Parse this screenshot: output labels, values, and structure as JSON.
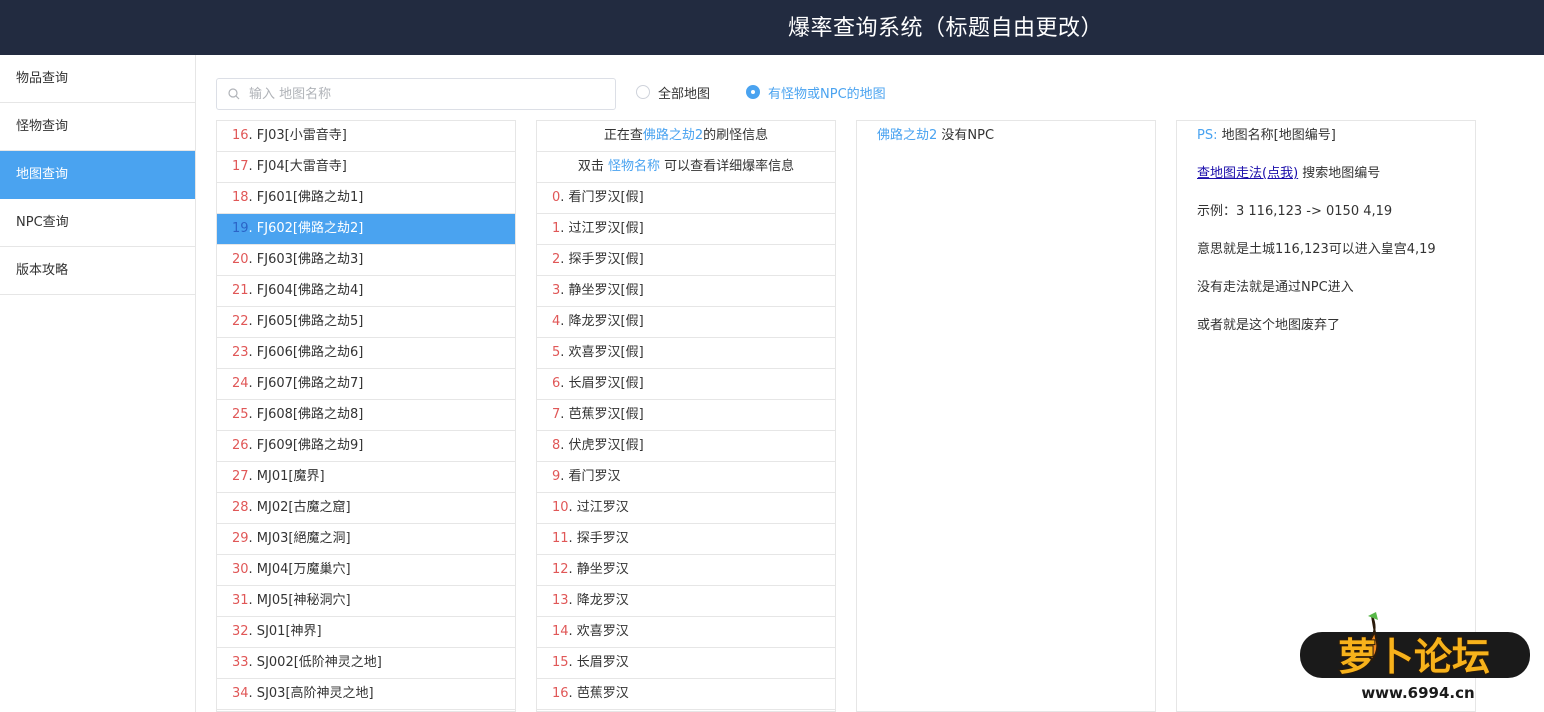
{
  "header": {
    "title": "爆率查询系统（标题自由更改）"
  },
  "sidebar": {
    "items": [
      {
        "label": "物品查询"
      },
      {
        "label": "怪物查询"
      },
      {
        "label": "地图查询",
        "active": true
      },
      {
        "label": "NPC查询"
      },
      {
        "label": "版本攻略"
      }
    ]
  },
  "search": {
    "placeholder": "输入 地图名称",
    "value": ""
  },
  "filter": {
    "options": [
      {
        "label": "全部地图",
        "checked": false
      },
      {
        "label": "有怪物或NPC的地图",
        "checked": true
      }
    ]
  },
  "map_list": {
    "rows": [
      {
        "index": "16",
        "name": ". FJ03[小雷音寺]"
      },
      {
        "index": "17",
        "name": ". FJ04[大雷音寺]"
      },
      {
        "index": "18",
        "name": ". FJ601[佛路之劫1]"
      },
      {
        "index": "19",
        "name": ". FJ602[佛路之劫2]",
        "selected": true
      },
      {
        "index": "20",
        "name": ". FJ603[佛路之劫3]"
      },
      {
        "index": "21",
        "name": ". FJ604[佛路之劫4]"
      },
      {
        "index": "22",
        "name": ". FJ605[佛路之劫5]"
      },
      {
        "index": "23",
        "name": ". FJ606[佛路之劫6]"
      },
      {
        "index": "24",
        "name": ". FJ607[佛路之劫7]"
      },
      {
        "index": "25",
        "name": ". FJ608[佛路之劫8]"
      },
      {
        "index": "26",
        "name": ". FJ609[佛路之劫9]"
      },
      {
        "index": "27",
        "name": ". MJ01[魔界]"
      },
      {
        "index": "28",
        "name": ". MJ02[古魔之窟]"
      },
      {
        "index": "29",
        "name": ". MJ03[絕魔之洞]"
      },
      {
        "index": "30",
        "name": ". MJ04[万魔巢穴]"
      },
      {
        "index": "31",
        "name": ". MJ05[神秘洞穴]"
      },
      {
        "index": "32",
        "name": ". SJ01[神界]"
      },
      {
        "index": "33",
        "name": ". SJ002[低阶神灵之地]"
      },
      {
        "index": "34",
        "name": ". SJ03[高阶神灵之地]"
      }
    ]
  },
  "monster_panel": {
    "head1_prefix": "正在查",
    "head1_map": "佛路之劫2",
    "head1_suffix": "的刷怪信息",
    "head2_prefix": "双击 ",
    "head2_link": "怪物名称",
    "head2_suffix": " 可以查看详细爆率信息",
    "rows": [
      {
        "index": "0",
        "name": ". 看门罗汉[假]"
      },
      {
        "index": "1",
        "name": ". 过江罗汉[假]"
      },
      {
        "index": "2",
        "name": ". 探手罗汉[假]"
      },
      {
        "index": "3",
        "name": ". 静坐罗汉[假]"
      },
      {
        "index": "4",
        "name": ". 降龙罗汉[假]"
      },
      {
        "index": "5",
        "name": ". 欢喜罗汉[假]"
      },
      {
        "index": "6",
        "name": ". 长眉罗汉[假]"
      },
      {
        "index": "7",
        "name": ". 芭蕉罗汉[假]"
      },
      {
        "index": "8",
        "name": ". 伏虎罗汉[假]"
      },
      {
        "index": "9",
        "name": ". 看门罗汉"
      },
      {
        "index": "10",
        "name": ". 过江罗汉"
      },
      {
        "index": "11",
        "name": ". 探手罗汉"
      },
      {
        "index": "12",
        "name": ". 静坐罗汉"
      },
      {
        "index": "13",
        "name": ". 降龙罗汉"
      },
      {
        "index": "14",
        "name": ". 欢喜罗汉"
      },
      {
        "index": "15",
        "name": ". 长眉罗汉"
      },
      {
        "index": "16",
        "name": ". 芭蕉罗汉"
      }
    ]
  },
  "npc_panel": {
    "map": "佛路之劫2",
    "text": " 没有NPC"
  },
  "info_panel": {
    "ps_label": "PS:",
    "ps_text": " 地图名称[地图编号]",
    "link_text": "查地图走法(点我)",
    "link_suffix": " 搜索地图编号",
    "example": "示例：3 116,123 -> 0150 4,19",
    "meaning": "意思就是土城116,123可以进入皇宫4,19",
    "no_route": "没有走法就是通过NPC进入",
    "abandoned": "或者就是这个地图废弃了"
  },
  "watermark": {
    "text": "萝卜论坛",
    "url": "www.6994.cn"
  },
  "colors": {
    "header_bg": "#222b40",
    "accent": "#4aa3f0",
    "index_red": "#e05757",
    "selected_index": "#2b64c7"
  }
}
